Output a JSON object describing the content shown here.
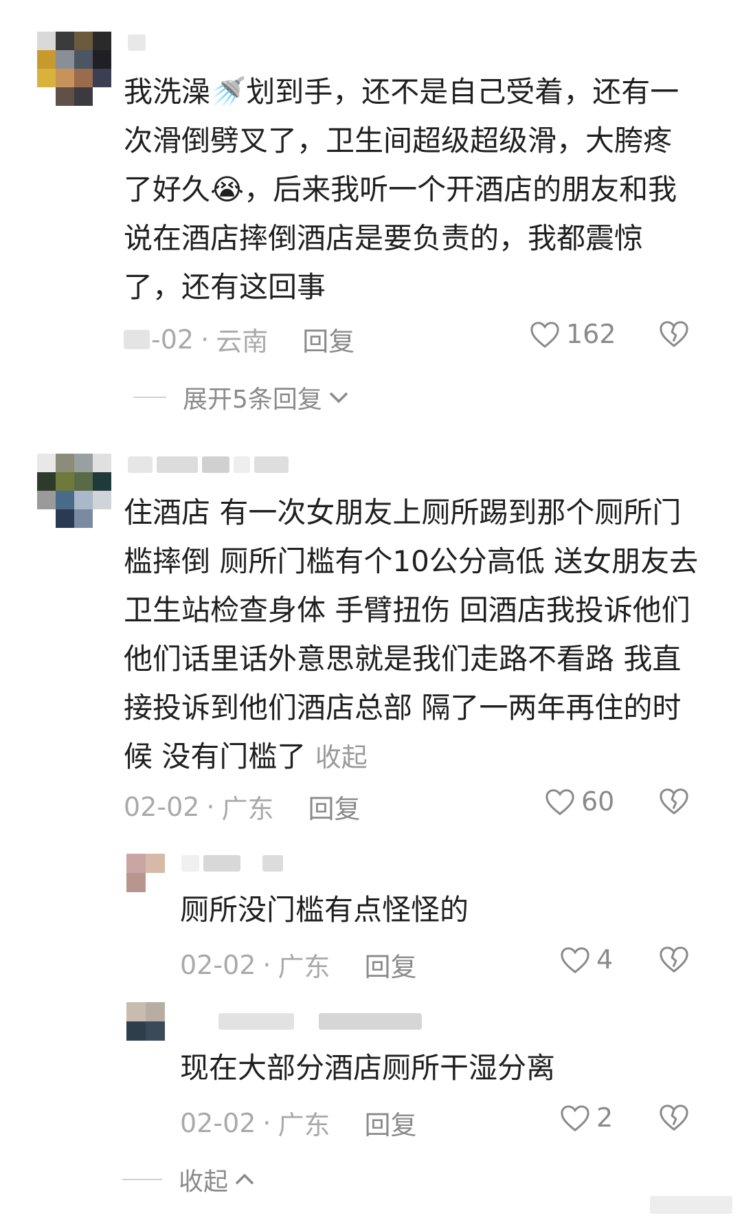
{
  "comments": [
    {
      "text": "我洗澡🚿划到手，还不是自己受着，还有一次滑倒劈叉了，卫生间超级超级滑，大胯疼了好久😭，后来我听一个开酒店的朋友和我说在酒店摔倒酒店是要负责的，我都震惊了，还有这回事",
      "date": "-02",
      "location": "云南",
      "reply_label": "回复",
      "likes": "162",
      "expand_label": "展开5条回复"
    },
    {
      "text": "住酒店 有一次女朋友上厕所踢到那个厕所门槛摔倒 厕所门槛有个10公分高低 送女朋友去卫生站检查身体 手臂扭伤 回酒店我投诉他们 他们话里话外意思就是我们走路不看路 我直接投诉到他们酒店总部 隔了一两年再住的时候 没有门槛了",
      "collapse_inline": "收起",
      "date": "02-02",
      "location": "广东",
      "reply_label": "回复",
      "likes": "60"
    }
  ],
  "replies": [
    {
      "text": "厕所没门槛有点怪怪的",
      "date": "02-02",
      "location": "广东",
      "reply_label": "回复",
      "likes": "4"
    },
    {
      "text": "现在大部分酒店厕所干湿分离",
      "date": "02-02",
      "location": "广东",
      "reply_label": "回复",
      "likes": "2"
    }
  ],
  "collapse_label": "收起",
  "separator": "·",
  "icons": {
    "like": "heart-outline-icon",
    "dislike": "broken-heart-icon",
    "expand": "chevron-down-icon",
    "collapse": "chevron-up-icon"
  },
  "colors": {
    "text": "#1f1f1f",
    "meta": "#a9a9a9",
    "action": "#8a8a8a"
  }
}
